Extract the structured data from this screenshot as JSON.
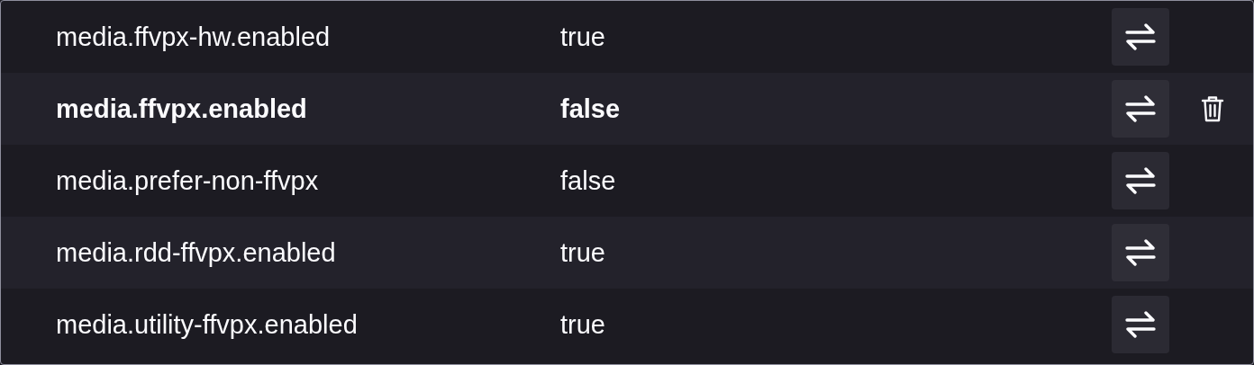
{
  "prefs": [
    {
      "name": "media.ffvpx-hw.enabled",
      "value": "true",
      "modified": false
    },
    {
      "name": "media.ffvpx.enabled",
      "value": "false",
      "modified": true
    },
    {
      "name": "media.prefer-non-ffvpx",
      "value": "false",
      "modified": false
    },
    {
      "name": "media.rdd-ffvpx.enabled",
      "value": "true",
      "modified": false
    },
    {
      "name": "media.utility-ffvpx.enabled",
      "value": "true",
      "modified": false
    }
  ]
}
